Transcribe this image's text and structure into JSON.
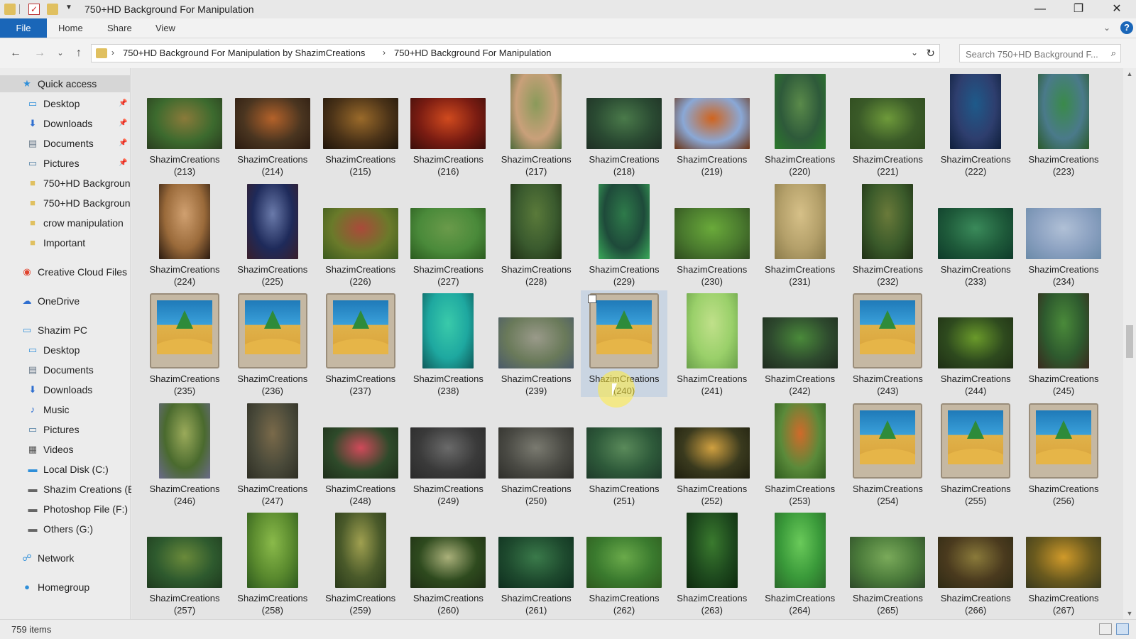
{
  "window": {
    "title": "750+HD Background For Manipulation",
    "controls": {
      "minimize": "—",
      "restore": "❐",
      "close": "✕"
    }
  },
  "ribbon": {
    "tabs": [
      "File",
      "Home",
      "Share",
      "View"
    ],
    "help": "?"
  },
  "address": {
    "crumbs": [
      "750+HD Background For Manipulation by ShazimCreations",
      "750+HD Background For Manipulation"
    ],
    "search_placeholder": "Search 750+HD Background F..."
  },
  "nav": {
    "items": [
      {
        "label": "Quick access",
        "icon": "star-icon",
        "level": 0,
        "pinned": false,
        "selected": true
      },
      {
        "label": "Desktop",
        "icon": "desktop-icon",
        "level": 1,
        "pinned": true
      },
      {
        "label": "Downloads",
        "icon": "download-icon",
        "level": 1,
        "pinned": true
      },
      {
        "label": "Documents",
        "icon": "document-icon",
        "level": 1,
        "pinned": true
      },
      {
        "label": "Pictures",
        "icon": "pictures-icon",
        "level": 1,
        "pinned": true
      },
      {
        "label": "750+HD Backgroun",
        "icon": "folder-icon",
        "level": 1
      },
      {
        "label": "750+HD Backgroun",
        "icon": "folder-icon",
        "level": 1
      },
      {
        "label": "crow manipulation",
        "icon": "folder-icon",
        "level": 1
      },
      {
        "label": "Important",
        "icon": "folder-icon",
        "level": 1
      },
      {
        "label": "Creative Cloud Files",
        "icon": "creative-cloud-icon",
        "level": 0,
        "gap": true
      },
      {
        "label": "OneDrive",
        "icon": "onedrive-icon",
        "level": 0,
        "gap": true
      },
      {
        "label": "Shazim PC",
        "icon": "computer-icon",
        "level": 0,
        "gap": true
      },
      {
        "label": "Desktop",
        "icon": "desktop-icon",
        "level": 1
      },
      {
        "label": "Documents",
        "icon": "document-icon",
        "level": 1
      },
      {
        "label": "Downloads",
        "icon": "download-icon",
        "level": 1
      },
      {
        "label": "Music",
        "icon": "music-icon",
        "level": 1
      },
      {
        "label": "Pictures",
        "icon": "pictures-icon",
        "level": 1
      },
      {
        "label": "Videos",
        "icon": "videos-icon",
        "level": 1
      },
      {
        "label": "Local Disk (C:)",
        "icon": "disk-icon",
        "level": 1
      },
      {
        "label": "Shazim Creations (E",
        "icon": "drive-icon",
        "level": 1
      },
      {
        "label": "Photoshop File (F:)",
        "icon": "drive-icon",
        "level": 1
      },
      {
        "label": "Others (G:)",
        "icon": "drive-icon",
        "level": 1
      },
      {
        "label": "Network",
        "icon": "network-icon",
        "level": 0,
        "gap": true
      },
      {
        "label": "Homegroup",
        "icon": "homegroup-icon",
        "level": 0,
        "gap": true
      }
    ]
  },
  "files": {
    "name": "ShazimCreations",
    "selected": 240,
    "items": [
      {
        "n": 213,
        "c": [
          "#3c6a2e",
          "#8a7a3a",
          "#2a3d1f"
        ],
        "o": "l"
      },
      {
        "n": 214,
        "c": [
          "#4a3520",
          "#b4622a",
          "#2a1a10"
        ],
        "o": "l"
      },
      {
        "n": 215,
        "c": [
          "#4b3318",
          "#9a6a2a",
          "#1e140a"
        ],
        "o": "l"
      },
      {
        "n": 216,
        "c": [
          "#7a1c12",
          "#d04a1e",
          "#3a0e0a"
        ],
        "o": "l"
      },
      {
        "n": 217,
        "c": [
          "#c9a07a",
          "#8a9a5a",
          "#4e6a3a"
        ],
        "o": "p"
      },
      {
        "n": 218,
        "c": [
          "#2a4a32",
          "#4a7a4a",
          "#1e2e24"
        ],
        "o": "l"
      },
      {
        "n": 219,
        "c": [
          "#8aa8d6",
          "#d0641e",
          "#6a3212"
        ],
        "o": "l"
      },
      {
        "n": 220,
        "c": [
          "#2e5a3a",
          "#5a8a4a",
          "#2a7a2a"
        ],
        "o": "p"
      },
      {
        "n": 221,
        "c": [
          "#3a5a28",
          "#6e9a3a",
          "#2e4a1e"
        ],
        "o": "l"
      },
      {
        "n": 222,
        "c": [
          "#2e3e6e",
          "#1e5a8a",
          "#0e1e3a"
        ],
        "o": "p"
      },
      {
        "n": 223,
        "c": [
          "#4a7a8a",
          "#3a8a4a",
          "#2a5a2a"
        ],
        "o": "p"
      },
      {
        "n": 224,
        "c": [
          "#9a6a3a",
          "#d0a070",
          "#2a1a10"
        ],
        "o": "p"
      },
      {
        "n": 225,
        "c": [
          "#1e2a5a",
          "#6a7aaa",
          "#3a1e2a"
        ],
        "o": "p"
      },
      {
        "n": 226,
        "c": [
          "#6a7a2a",
          "#aa4a3a",
          "#3a5a1e"
        ],
        "o": "l"
      },
      {
        "n": 227,
        "c": [
          "#4a8a3a",
          "#6a9a4a",
          "#2a5a1e"
        ],
        "o": "l"
      },
      {
        "n": 228,
        "c": [
          "#3a5a2e",
          "#5a7a3a",
          "#1e2e14"
        ],
        "o": "p"
      },
      {
        "n": 229,
        "c": [
          "#1e4a3a",
          "#2e7a4a",
          "#3aaa5a"
        ],
        "o": "p"
      },
      {
        "n": 230,
        "c": [
          "#4a7a2e",
          "#6aaa3a",
          "#2e4a1e"
        ],
        "o": "l"
      },
      {
        "n": 231,
        "c": [
          "#b4a06a",
          "#d6c088",
          "#8a7a4a"
        ],
        "o": "p"
      },
      {
        "n": 232,
        "c": [
          "#3a5a2a",
          "#6a7a3a",
          "#1e2e14"
        ],
        "o": "p"
      },
      {
        "n": 233,
        "c": [
          "#1e5a3a",
          "#3a8a5a",
          "#0e3a2a"
        ],
        "o": "l"
      },
      {
        "n": 234,
        "c": [
          "#8aa0c0",
          "#b0c0d6",
          "#6a8aa8"
        ],
        "o": "l"
      },
      {
        "n": 235,
        "ph": true
      },
      {
        "n": 236,
        "ph": true
      },
      {
        "n": 237,
        "ph": true
      },
      {
        "n": 238,
        "c": [
          "#1ea8a0",
          "#3acaaa",
          "#0e5a5a"
        ],
        "o": "p"
      },
      {
        "n": 239,
        "c": [
          "#6a7a5a",
          "#9a9a8a",
          "#4a5a6a"
        ],
        "o": "l"
      },
      {
        "n": 240,
        "ph": true
      },
      {
        "n": 241,
        "c": [
          "#9ad06a",
          "#c0e08a",
          "#6aa04a"
        ],
        "o": "p"
      },
      {
        "n": 242,
        "c": [
          "#2e4a2e",
          "#4a8a3a",
          "#1e2a1e"
        ],
        "o": "l"
      },
      {
        "n": 243,
        "ph": true
      },
      {
        "n": 244,
        "c": [
          "#2e4a1e",
          "#6a9a2a",
          "#1e2e14"
        ],
        "o": "l"
      },
      {
        "n": 245,
        "c": [
          "#2e5a2e",
          "#4a8a3a",
          "#3a2a1e"
        ],
        "o": "p"
      },
      {
        "n": 246,
        "c": [
          "#4a6a2e",
          "#9aaa5a",
          "#6a6a8a"
        ],
        "o": "p"
      },
      {
        "n": 247,
        "c": [
          "#4a4a3a",
          "#7a6a4a",
          "#2e2e24"
        ],
        "o": "p"
      },
      {
        "n": 248,
        "c": [
          "#2e4a2a",
          "#d04a5a",
          "#1e2e1a"
        ],
        "o": "l"
      },
      {
        "n": 249,
        "c": [
          "#3a3a3a",
          "#6a6a6a",
          "#2a2a2a"
        ],
        "o": "l"
      },
      {
        "n": 250,
        "c": [
          "#4a4a44",
          "#7a7a70",
          "#2e2e2a"
        ],
        "o": "l"
      },
      {
        "n": 251,
        "c": [
          "#2e5a3a",
          "#5a8a5a",
          "#1e3a2a"
        ],
        "o": "l"
      },
      {
        "n": 252,
        "c": [
          "#3a3a1e",
          "#d0a040",
          "#1e1e0e"
        ],
        "o": "l"
      },
      {
        "n": 253,
        "c": [
          "#5a8a3a",
          "#d06a2a",
          "#2e5a1e"
        ],
        "o": "p"
      },
      {
        "n": 254,
        "ph": true
      },
      {
        "n": 255,
        "ph": true
      },
      {
        "n": 256,
        "ph": true
      },
      {
        "n": 257,
        "c": [
          "#2e5a2e",
          "#6a8a3a",
          "#1e3a1e"
        ],
        "o": "l"
      },
      {
        "n": 258,
        "c": [
          "#5a8a2e",
          "#8aba4a",
          "#2e5a1e"
        ],
        "o": "p"
      },
      {
        "n": 259,
        "c": [
          "#4a5a2a",
          "#a0a050",
          "#2a3a1a"
        ],
        "o": "p"
      },
      {
        "n": 260,
        "c": [
          "#2e4a1e",
          "#aab07a",
          "#1e2e14"
        ],
        "o": "l"
      },
      {
        "n": 261,
        "c": [
          "#1e4a2e",
          "#3a7a4a",
          "#0e2e1e"
        ],
        "o": "l"
      },
      {
        "n": 262,
        "c": [
          "#3a7a2e",
          "#6aaa4a",
          "#2e5a1e"
        ],
        "o": "l"
      },
      {
        "n": 263,
        "c": [
          "#1e4a1e",
          "#3a7a2e",
          "#0e2a0e"
        ],
        "o": "p"
      },
      {
        "n": 264,
        "c": [
          "#3a9a3a",
          "#6aca5a",
          "#2a6a2a"
        ],
        "o": "p"
      },
      {
        "n": 265,
        "c": [
          "#4a7a3a",
          "#7aaa5a",
          "#2e4a2a"
        ],
        "o": "l"
      },
      {
        "n": 266,
        "c": [
          "#4a3a1e",
          "#8a7a3a",
          "#2e2a14"
        ],
        "o": "l"
      },
      {
        "n": 267,
        "c": [
          "#6a5a1e",
          "#d09a2a",
          "#3a3a1e"
        ],
        "o": "l"
      }
    ]
  },
  "status": {
    "count": "759 items"
  }
}
